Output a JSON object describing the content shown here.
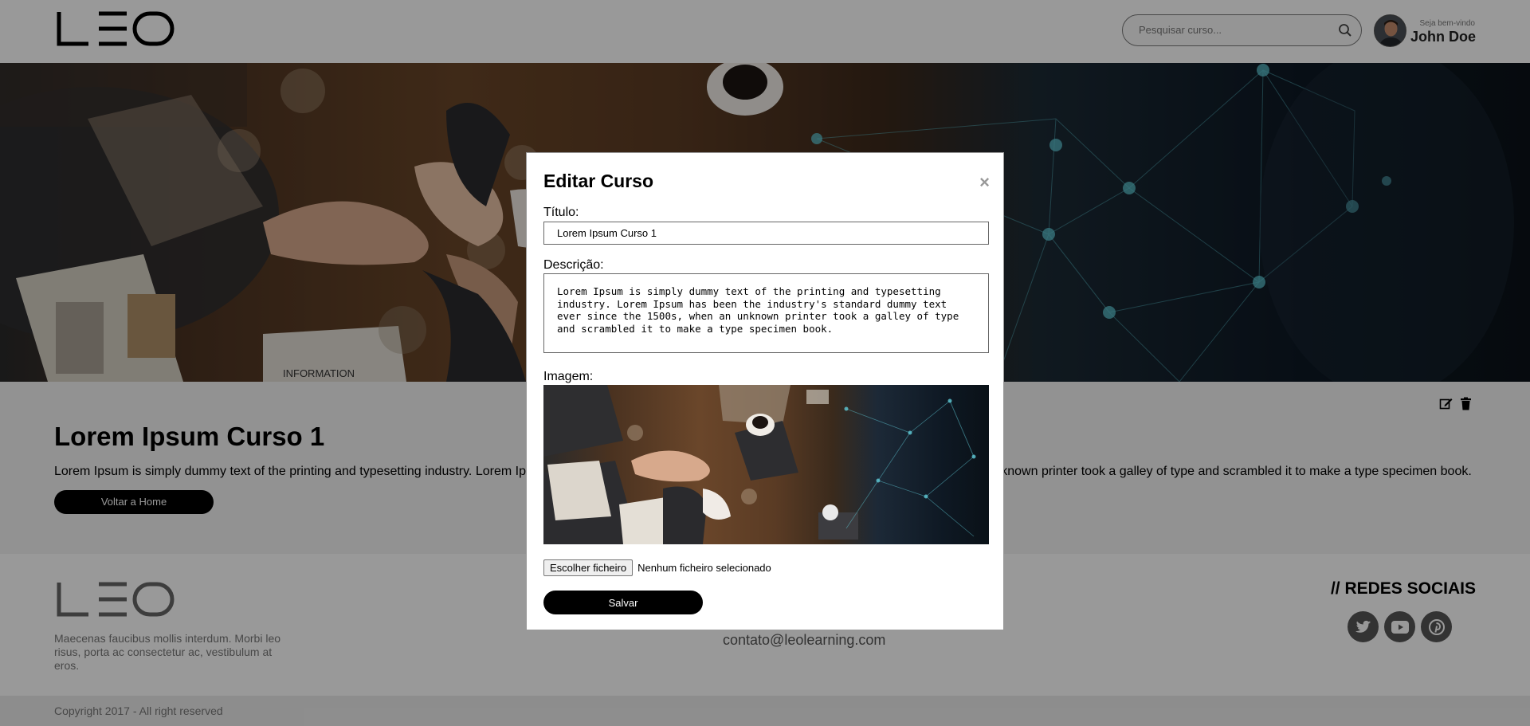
{
  "header": {
    "logo": "LEO",
    "search_placeholder": "Pesquisar curso...",
    "welcome": "Seja bem-vindo",
    "username": "John Doe"
  },
  "hero": {
    "paper_label": "INFORMATION"
  },
  "course": {
    "title": "Lorem Ipsum Curso 1",
    "description": "Lorem Ipsum is simply dummy text of the printing and typesetting industry. Lorem Ipsum has been the industry's standard dummy text ever since the 1500s, when an unknown printer took a galley of type and scrambled it to make a type specimen book.",
    "home_button": "Voltar a Home"
  },
  "footer": {
    "logo": "LEO",
    "text": "Maecenas faucibus mollis interdum. Morbi leo risus, porta ac consectetur ac, vestibulum at eros.",
    "contact": "contato@leolearning.com",
    "social_title": "// REDES SOCIAIS",
    "social_icons": [
      "twitter-icon",
      "youtube-icon",
      "pinterest-icon"
    ],
    "copyright": "Copyright 2017 - All right reserved"
  },
  "modal": {
    "title": "Editar Curso",
    "close": "×",
    "title_label": "Título:",
    "title_value": "Lorem Ipsum Curso 1",
    "description_label": "Descrição:",
    "description_value": "Lorem Ipsum is simply dummy text of the printing and typesetting industry. Lorem Ipsum has been the industry's standard dummy text ever since the 1500s, when an unknown printer took a galley of type and scrambled it to make a type specimen book.",
    "image_label": "Imagem:",
    "file_button": "Escolher ficheiro",
    "file_status": "Nenhum ficheiro selecionado",
    "save_button": "Salvar"
  },
  "colors": {
    "button_bg": "#000000",
    "overlay": "rgba(0,0,0,0.4)",
    "hero_network": "#5fc9d6"
  }
}
